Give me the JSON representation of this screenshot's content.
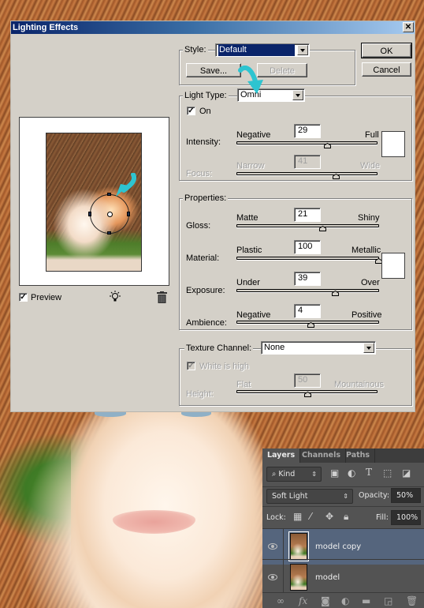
{
  "dialog": {
    "title": "Lighting Effects",
    "close_label": "✕",
    "ok_label": "OK",
    "cancel_label": "Cancel",
    "style": {
      "label": "Style:",
      "value": "Default",
      "save_label": "Save...",
      "delete_label": "Delete"
    },
    "light_type": {
      "label": "Light Type:",
      "value": "Omni",
      "on_label": "On",
      "on_checked": true,
      "intensity": {
        "label": "Intensity:",
        "min_label": "Negative",
        "max_label": "Full",
        "value": "29",
        "range": [
          -100,
          100
        ]
      },
      "focus": {
        "label": "Focus:",
        "min_label": "Narrow",
        "max_label": "Wide",
        "value": "41",
        "range": [
          -100,
          100
        ],
        "disabled": true
      },
      "color_swatch": "#ffffff"
    },
    "properties": {
      "label": "Properties:",
      "color_swatch": "#ffffff",
      "gloss": {
        "label": "Gloss:",
        "min_label": "Matte",
        "max_label": "Shiny",
        "value": "21",
        "range": [
          -100,
          100
        ]
      },
      "material": {
        "label": "Material:",
        "min_label": "Plastic",
        "max_label": "Metallic",
        "value": "100",
        "range": [
          -100,
          100
        ]
      },
      "exposure": {
        "label": "Exposure:",
        "min_label": "Under",
        "max_label": "Over",
        "value": "39",
        "range": [
          -100,
          100
        ]
      },
      "ambience": {
        "label": "Ambience:",
        "min_label": "Negative",
        "max_label": "Positive",
        "value": "4",
        "range": [
          -100,
          100
        ]
      }
    },
    "texture": {
      "label": "Texture Channel:",
      "value": "None",
      "white_is_high_label": "White is high",
      "white_is_high_checked": true,
      "height": {
        "label": "Height:",
        "min_label": "Flat",
        "max_label": "Mountainous",
        "value": "50",
        "range": [
          0,
          100
        ],
        "disabled": true
      }
    },
    "preview": {
      "label": "Preview",
      "checked": true,
      "new_light_icon": "lightbulb-icon",
      "delete_icon": "trash-icon"
    }
  },
  "layers_panel": {
    "tabs": [
      "Layers",
      "Channels",
      "Paths"
    ],
    "active_tab": "Layers",
    "filter": {
      "label": "Kind",
      "icons": [
        "image-filter-icon",
        "adjustment-filter-icon",
        "type-filter-icon",
        "shape-filter-icon",
        "smart-object-filter-icon"
      ]
    },
    "blend_mode": "Soft Light",
    "opacity_label": "Opacity:",
    "opacity_value": "50%",
    "lock_label": "Lock:",
    "fill_label": "Fill:",
    "fill_value": "100%",
    "layers": [
      {
        "name": "model copy",
        "visible": true,
        "selected": true
      },
      {
        "name": "model",
        "visible": true,
        "selected": false
      }
    ],
    "footer_icons": [
      "link-icon",
      "fx-icon",
      "mask-icon",
      "adjustment-icon",
      "folder-icon",
      "new-layer-icon",
      "trash-icon"
    ]
  },
  "annotation": {
    "arrow_color": "#2ec4d0"
  }
}
